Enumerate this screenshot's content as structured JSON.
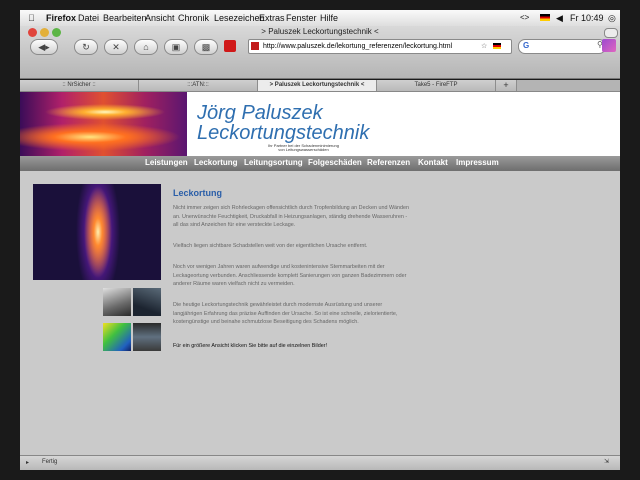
{
  "menubar": {
    "app": "Firefox",
    "items": [
      "Datei",
      "Bearbeiten",
      "Ansicht",
      "Chronik",
      "Lesezeichen",
      "Extras",
      "Fenster",
      "Hilfe"
    ],
    "clock": "Fr 10:49"
  },
  "window": {
    "title": "> Paluszek Leckortungstechnik <"
  },
  "toolbar": {
    "url": "http://www.paluszek.de/lekortung_referenzen/leckortung.html",
    "search_placeholder": ""
  },
  "tabs": [
    {
      "label": ":: NrSicher ::"
    },
    {
      "label": ":::ATN:::"
    },
    {
      "label": "> Paluszek Leckortungstechnik <"
    },
    {
      "label": "Take5 - FireFTP"
    },
    {
      "label": "+"
    }
  ],
  "site": {
    "brand_line1": "Jörg Paluszek",
    "brand_line2": "Leckortungstechnik",
    "tagline_line1": "Ihr Partner bei der Schadenminimierung",
    "tagline_line2": "von Leitungswasserschäden",
    "nav": [
      "Leistungen",
      "Leckortung",
      "Leitungsortung",
      "Folgeschäden",
      "Referenzen",
      "Kontakt",
      "Impressum"
    ]
  },
  "content": {
    "title": "Leckortung",
    "paragraphs": [
      "Nicht immer zeigen sich Rohrleckagen offensichtlich durch Tropfenbildung an Decken und Wänden an. Unerwünschte Feuchtigkeit, Druckabfall in Heizungsanlagen, ständig drehende Wasseruhren - all das sind Anzeichen für eine versteckte Leckage.",
      "Vielfach liegen sichtbare Schadstellen weit von der eigentlichen Ursache entfernt.",
      "Noch vor wenigen Jahren waren aufwendige und kostenintensive Stemmarbeiten mit der Leckageortung verbunden. Anschliessende komplett Sanierungen von ganzen Badezimmern oder anderer Räume waren vielfach nicht zu vermeiden.",
      "Die heutige Leckortungstechnik gewährleistet durch modernste Ausrüstung und unserer langjährigen Erfahrung das präzise Auffinden der Ursache. So ist eine schnelle, zielorientierte, kostengünstige und beinahe schmutzlose Beseitigung des Schadens möglich."
    ],
    "final": "Für ein größere Ansicht klicken Sie bitte auf die einzelnen Bilder!"
  },
  "status": {
    "text": "Fertig"
  },
  "colors": {
    "brand_blue": "#2f6fb0",
    "nav_gray": "#7d7d7d",
    "page_bg": "#cacaca"
  }
}
